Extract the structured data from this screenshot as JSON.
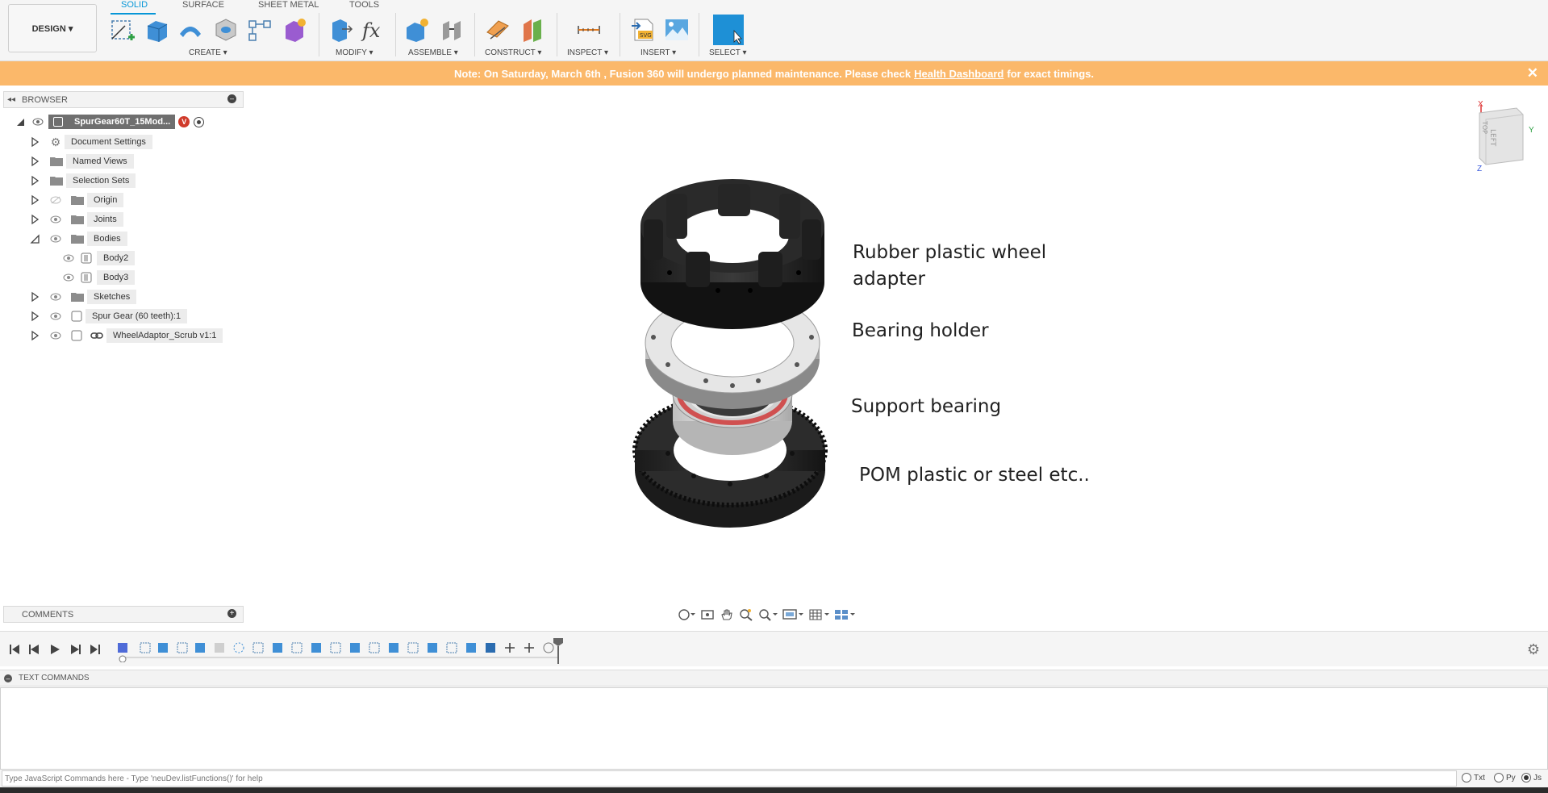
{
  "workspace": {
    "label": "DESIGN ▾"
  },
  "tabs": [
    {
      "label": "SOLID",
      "active": true
    },
    {
      "label": "SURFACE",
      "active": false
    },
    {
      "label": "SHEET METAL",
      "active": false
    },
    {
      "label": "TOOLS",
      "active": false
    }
  ],
  "groups": {
    "create": "CREATE ▾",
    "modify": "MODIFY ▾",
    "assemble": "ASSEMBLE ▾",
    "construct": "CONSTRUCT ▾",
    "inspect": "INSPECT ▾",
    "insert": "INSERT ▾",
    "select": "SELECT ▾"
  },
  "notice": {
    "before": "Note: On Saturday, March 6th , Fusion 360 will undergo planned maintenance. Please check",
    "link": "Health Dashboard",
    "after": "for exact timings.",
    "close": "✕"
  },
  "browser": {
    "title": "BROWSER",
    "root": "SpurGear60T_15Mod...",
    "items": [
      {
        "label": "Document Settings"
      },
      {
        "label": "Named Views"
      },
      {
        "label": "Selection Sets"
      },
      {
        "label": "Origin"
      },
      {
        "label": "Joints"
      },
      {
        "label": "Bodies"
      },
      {
        "label": "Body2"
      },
      {
        "label": "Body3"
      },
      {
        "label": "Sketches"
      },
      {
        "label": "Spur Gear (60 teeth):1"
      },
      {
        "label": "WheelAdaptor_Scrub v1:1"
      }
    ]
  },
  "viewcube": {
    "top": "TOP",
    "left": "LEFT",
    "x": "X",
    "y": "Y",
    "z": "Z"
  },
  "callouts": {
    "wheel_adapter_line1": "Rubber plastic wheel",
    "wheel_adapter_line2": "adapter",
    "bearing_holder": "Bearing holder",
    "support_bearing": "Support bearing",
    "gear_material": "POM plastic or steel etc.."
  },
  "comments": {
    "title": "COMMENTS"
  },
  "text_commands": {
    "title": "TEXT COMMANDS",
    "placeholder": "Type JavaScript Commands here - Type 'neuDev.listFunctions()' for help",
    "options": [
      "Txt",
      "Py",
      "Js"
    ],
    "selected": "Js"
  },
  "colors": {
    "accent": "#0696d7",
    "notice": "#fbb86a",
    "select_tile": "#1e90d6",
    "bearing_seal": "#d05050"
  }
}
